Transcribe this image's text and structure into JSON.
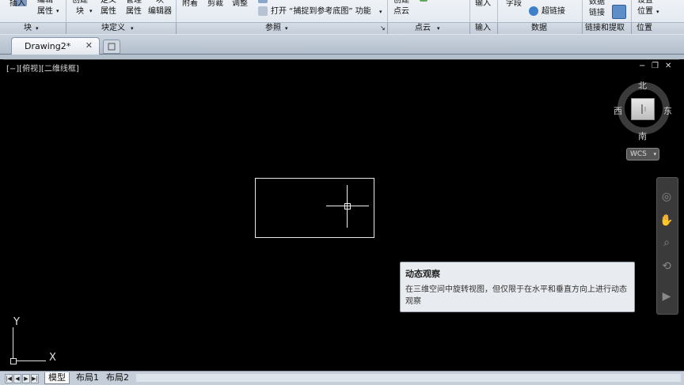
{
  "ribbon": {
    "block_panel": {
      "title": "块",
      "insert": "插入",
      "edit_attr_1": "编辑",
      "edit_attr_2": "属性"
    },
    "block_def_panel": {
      "title": "块定义",
      "create_1": "创建",
      "create_2": "块",
      "define_attr_1": "定义",
      "define_attr_2": "属性",
      "manage_attr_1": "管理",
      "manage_attr_2": "属性",
      "block_editor_1": "块",
      "block_editor_2": "编辑器"
    },
    "reference_panel": {
      "title": "参照",
      "attach": "附着",
      "clip": "剪裁",
      "adjust": "调整",
      "snap_toggle": "打开 “捕捉到参考底图” 功能"
    },
    "pointcloud_panel": {
      "title": "点云",
      "create_1": "创建",
      "create_2": "点云"
    },
    "import_panel": {
      "title": "输入",
      "import": "输入"
    },
    "data_panel": {
      "title": "数据",
      "field": "字段",
      "hyperlink": "超链接"
    },
    "linking_panel": {
      "title": "链接和提取",
      "data_link_1": "数据",
      "data_link_2": "链接"
    },
    "location_panel": {
      "title": "位置",
      "set_location_1": "设置",
      "set_location_2": "位置"
    }
  },
  "tabs": {
    "drawing": "Drawing2*",
    "close": "✕"
  },
  "viewport": {
    "label": "[−][俯视][二维线框]",
    "window_min": "−",
    "window_restore": "❐",
    "window_close": "✕"
  },
  "viewcube": {
    "north": "北",
    "south": "南",
    "east": "东",
    "west": "西",
    "wcs": "WCS"
  },
  "tooltip": {
    "title": "动态观察",
    "description": "在三维空间中旋转视图，但仅限于在水平和垂直方向上进行动态观察"
  },
  "ucs": {
    "x": "X",
    "y": "Y"
  },
  "layout_tabs": {
    "model": "模型",
    "layout1": "布局1",
    "layout2": "布局2"
  },
  "colors": {
    "canvas": "#000000",
    "tooltip_bg": "#e8ebef",
    "ribbon_bg": "#e4eaf1"
  }
}
